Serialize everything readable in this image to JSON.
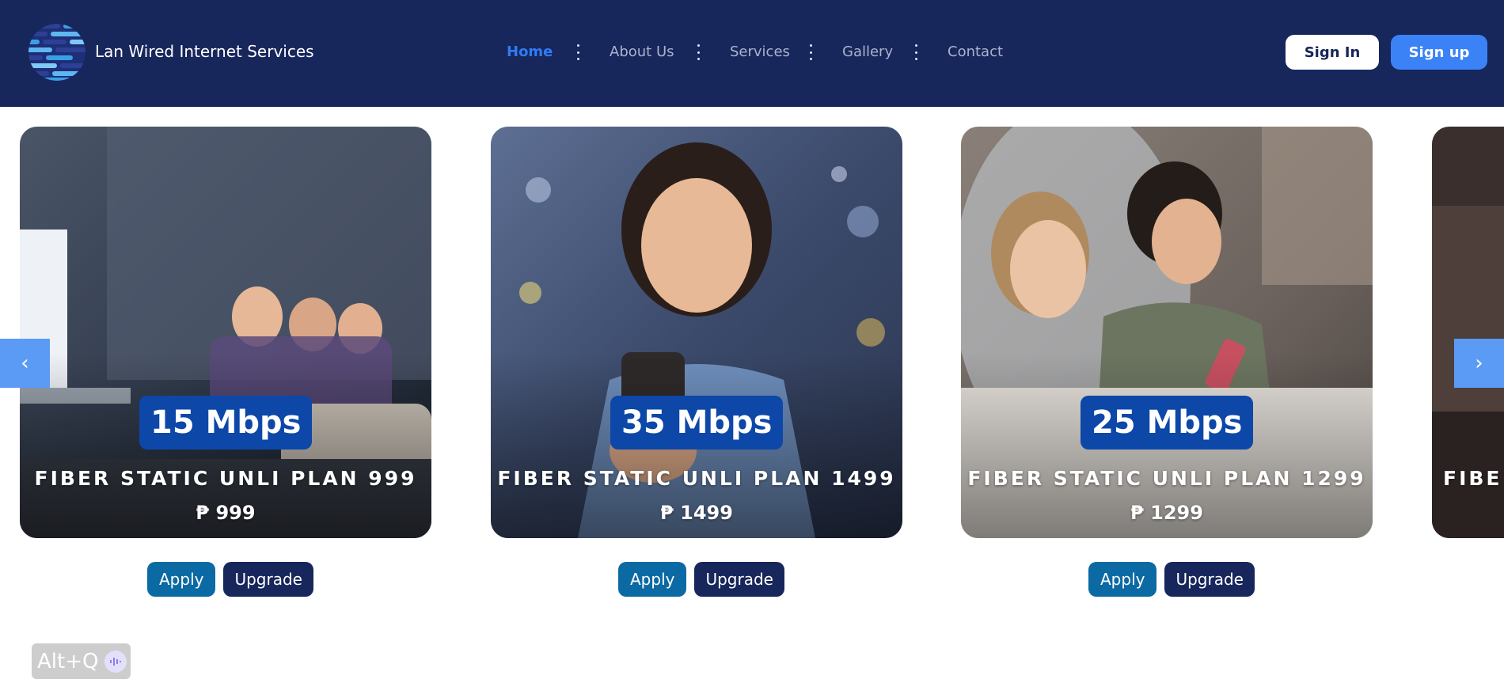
{
  "brand": {
    "name": "Lan Wired Internet Services",
    "logo_icon": "striped-globe-icon"
  },
  "nav": {
    "items": [
      {
        "label": "Home",
        "active": true
      },
      {
        "label": "About Us",
        "active": false
      },
      {
        "label": "Services",
        "active": false
      },
      {
        "label": "Gallery",
        "active": false
      },
      {
        "label": "Contact",
        "active": false
      }
    ],
    "separator_icon": "kebab-icon"
  },
  "auth": {
    "sign_in": "Sign In",
    "sign_up": "Sign up"
  },
  "carousel": {
    "prev_label": "‹",
    "next_label": "›",
    "plans": [
      {
        "speed": "15 Mbps",
        "name": "FIBER STATIC UNLI PLAN 999",
        "price": "₱ 999",
        "apply": "Apply",
        "upgrade": "Upgrade"
      },
      {
        "speed": "35 Mbps",
        "name": "FIBER STATIC UNLI PLAN 1499",
        "price": "₱ 1499",
        "apply": "Apply",
        "upgrade": "Upgrade"
      },
      {
        "speed": "25 Mbps",
        "name": "FIBER STATIC UNLI PLAN 1299",
        "price": "₱ 1299",
        "apply": "Apply",
        "upgrade": "Upgrade"
      },
      {
        "name_partial": "FIBE"
      }
    ]
  },
  "shortcut": {
    "label": "Alt+Q",
    "icon": "voice-wave-icon"
  },
  "colors": {
    "header_bg": "#17265b",
    "nav_active": "#2f7cf6",
    "signup_bg": "#3b82f6",
    "apply_bg": "#0b6aa3",
    "upgrade_bg": "#17265b",
    "badge_bg": "#0d47a8",
    "arrow_bg": "#5b9bf5"
  }
}
